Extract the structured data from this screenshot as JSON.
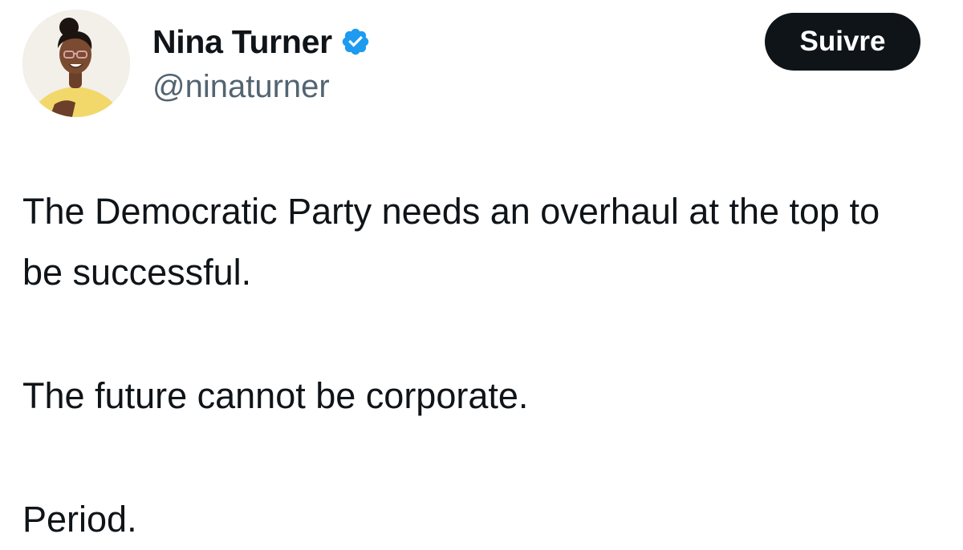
{
  "author": {
    "display_name": "Nina Turner",
    "handle": "@ninaturner",
    "verified": true,
    "avatar_icon": "profile-photo",
    "verified_icon": "verified-badge-icon",
    "verified_color": "#1d9bf0"
  },
  "follow_button": {
    "label": "Suivre",
    "background": "#0f1419",
    "text_color": "#ffffff"
  },
  "tweet": {
    "paragraphs": [
      "The Democratic Party needs an overhaul at the top to be successful.",
      "The future cannot be corporate.",
      "Period."
    ]
  }
}
